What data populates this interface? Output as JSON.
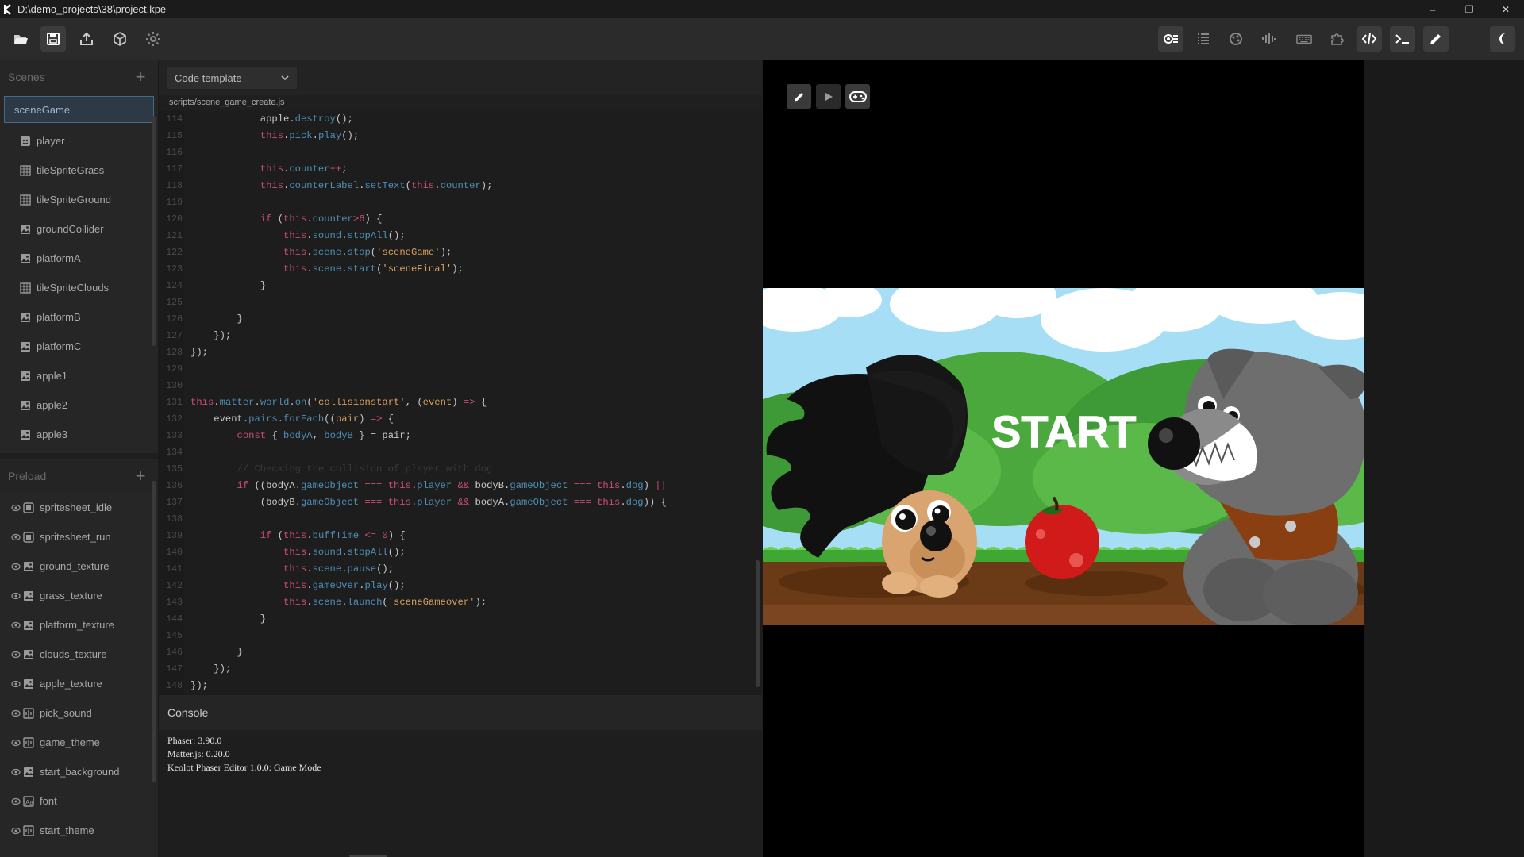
{
  "window": {
    "title": "D:\\demo_projects\\38\\project.kpe",
    "minimize": "–",
    "restore": "❐",
    "close": "✕"
  },
  "sidebar": {
    "scenes_label": "Scenes",
    "scene_selected": "sceneGame",
    "objects": [
      {
        "label": "player",
        "icon": "sprite-icon"
      },
      {
        "label": "tileSpriteGrass",
        "icon": "tilesprite-icon"
      },
      {
        "label": "tileSpriteGround",
        "icon": "tilesprite-icon"
      },
      {
        "label": "groundCollider",
        "icon": "image-icon"
      },
      {
        "label": "platformA",
        "icon": "image-icon"
      },
      {
        "label": "tileSpriteClouds",
        "icon": "tilesprite-icon"
      },
      {
        "label": "platformB",
        "icon": "image-icon"
      },
      {
        "label": "platformC",
        "icon": "image-icon"
      },
      {
        "label": "apple1",
        "icon": "image-icon"
      },
      {
        "label": "apple2",
        "icon": "image-icon"
      },
      {
        "label": "apple3",
        "icon": "image-icon"
      }
    ],
    "preload_label": "Preload",
    "preload": [
      {
        "label": "spritesheet_idle",
        "icon": "spritesheet-icon"
      },
      {
        "label": "spritesheet_run",
        "icon": "spritesheet-icon"
      },
      {
        "label": "ground_texture",
        "icon": "image-icon"
      },
      {
        "label": "grass_texture",
        "icon": "image-icon"
      },
      {
        "label": "platform_texture",
        "icon": "image-icon"
      },
      {
        "label": "clouds_texture",
        "icon": "image-icon"
      },
      {
        "label": "apple_texture",
        "icon": "image-icon"
      },
      {
        "label": "pick_sound",
        "icon": "audio-icon"
      },
      {
        "label": "game_theme",
        "icon": "audio-icon"
      },
      {
        "label": "start_background",
        "icon": "image-icon"
      },
      {
        "label": "font",
        "icon": "font-icon"
      },
      {
        "label": "start_theme",
        "icon": "audio-icon"
      }
    ]
  },
  "editor": {
    "template_select": "Code template",
    "file_path": "scripts/scene_game_create.js",
    "lines": [
      {
        "n": "114",
        "segs": [
          [
            "pl",
            "            apple."
          ],
          [
            "pr",
            "destroy"
          ],
          [
            "pl",
            "();"
          ]
        ]
      },
      {
        "n": "115",
        "segs": [
          [
            "kw",
            "            this"
          ],
          [
            "pl",
            "."
          ],
          [
            "pr",
            "pick"
          ],
          [
            "pl",
            "."
          ],
          [
            "pr",
            "play"
          ],
          [
            "pl",
            "();"
          ]
        ]
      },
      {
        "n": "116",
        "segs": []
      },
      {
        "n": "117",
        "segs": [
          [
            "kw",
            "            this"
          ],
          [
            "pl",
            "."
          ],
          [
            "pr",
            "counter"
          ],
          [
            "kw",
            "++"
          ],
          [
            "pl",
            ";"
          ]
        ]
      },
      {
        "n": "118",
        "segs": [
          [
            "kw",
            "            this"
          ],
          [
            "pl",
            "."
          ],
          [
            "pr",
            "counterLabel"
          ],
          [
            "pl",
            "."
          ],
          [
            "pr",
            "setText"
          ],
          [
            "pl",
            "("
          ],
          [
            "kw",
            "this"
          ],
          [
            "pl",
            "."
          ],
          [
            "pr",
            "counter"
          ],
          [
            "pl",
            ");"
          ]
        ]
      },
      {
        "n": "119",
        "segs": []
      },
      {
        "n": "120",
        "segs": [
          [
            "kw",
            "            if"
          ],
          [
            "pl",
            " ("
          ],
          [
            "kw",
            "this"
          ],
          [
            "pl",
            "."
          ],
          [
            "pr",
            "counter"
          ],
          [
            "kw",
            ">"
          ],
          [
            "nm",
            "6"
          ],
          [
            "pl",
            ") {"
          ]
        ]
      },
      {
        "n": "121",
        "segs": [
          [
            "kw",
            "                this"
          ],
          [
            "pl",
            "."
          ],
          [
            "pr",
            "sound"
          ],
          [
            "pl",
            "."
          ],
          [
            "pr",
            "stopAll"
          ],
          [
            "pl",
            "();"
          ]
        ]
      },
      {
        "n": "122",
        "segs": [
          [
            "kw",
            "                this"
          ],
          [
            "pl",
            "."
          ],
          [
            "pr",
            "scene"
          ],
          [
            "pl",
            "."
          ],
          [
            "pr",
            "stop"
          ],
          [
            "pl",
            "("
          ],
          [
            "st",
            "'sceneGame'"
          ],
          [
            "pl",
            ");"
          ]
        ]
      },
      {
        "n": "123",
        "segs": [
          [
            "kw",
            "                this"
          ],
          [
            "pl",
            "."
          ],
          [
            "pr",
            "scene"
          ],
          [
            "pl",
            "."
          ],
          [
            "pr",
            "start"
          ],
          [
            "pl",
            "("
          ],
          [
            "st",
            "'sceneFinal'"
          ],
          [
            "pl",
            ");"
          ]
        ]
      },
      {
        "n": "124",
        "segs": [
          [
            "pl",
            "            }"
          ]
        ]
      },
      {
        "n": "125",
        "segs": []
      },
      {
        "n": "126",
        "segs": [
          [
            "pl",
            "        }"
          ]
        ]
      },
      {
        "n": "127",
        "segs": [
          [
            "pl",
            "    });"
          ]
        ]
      },
      {
        "n": "128",
        "segs": [
          [
            "pl",
            "});"
          ]
        ]
      },
      {
        "n": "129",
        "segs": []
      },
      {
        "n": "130",
        "segs": []
      },
      {
        "n": "131",
        "segs": [
          [
            "kw",
            "this"
          ],
          [
            "pl",
            "."
          ],
          [
            "pr",
            "matter"
          ],
          [
            "pl",
            "."
          ],
          [
            "pr",
            "world"
          ],
          [
            "pl",
            "."
          ],
          [
            "pr",
            "on"
          ],
          [
            "pl",
            "("
          ],
          [
            "st",
            "'collisionstart'"
          ],
          [
            "pl",
            ", ("
          ],
          [
            "st",
            "event"
          ],
          [
            "pl",
            ") "
          ],
          [
            "kw",
            "=>"
          ],
          [
            "pl",
            " {"
          ]
        ]
      },
      {
        "n": "132",
        "segs": [
          [
            "pl",
            "    event."
          ],
          [
            "pr",
            "pairs"
          ],
          [
            "pl",
            "."
          ],
          [
            "pr",
            "forEach"
          ],
          [
            "pl",
            "(("
          ],
          [
            "st",
            "pair"
          ],
          [
            "pl",
            ") "
          ],
          [
            "kw",
            "=>"
          ],
          [
            "pl",
            " {"
          ]
        ]
      },
      {
        "n": "133",
        "segs": [
          [
            "kw",
            "        const"
          ],
          [
            "pl",
            " { "
          ],
          [
            "pr",
            "bodyA"
          ],
          [
            "pl",
            ", "
          ],
          [
            "pr",
            "bodyB"
          ],
          [
            "pl",
            " } = pair;"
          ]
        ]
      },
      {
        "n": "134",
        "segs": []
      },
      {
        "n": "135",
        "segs": [
          [
            "cm",
            "        // Checking the collision of player with dog"
          ]
        ]
      },
      {
        "n": "136",
        "segs": [
          [
            "kw",
            "        if"
          ],
          [
            "pl",
            " ((bodyA."
          ],
          [
            "pr",
            "gameObject"
          ],
          [
            "kw",
            " === "
          ],
          [
            "kw",
            "this"
          ],
          [
            "pl",
            "."
          ],
          [
            "pr",
            "player"
          ],
          [
            "kw",
            " && "
          ],
          [
            "pl",
            "bodyB."
          ],
          [
            "pr",
            "gameObject"
          ],
          [
            "kw",
            " === "
          ],
          [
            "kw",
            "this"
          ],
          [
            "pl",
            "."
          ],
          [
            "pr",
            "dog"
          ],
          [
            "pl",
            ") "
          ],
          [
            "kw",
            "||"
          ]
        ]
      },
      {
        "n": "137",
        "segs": [
          [
            "pl",
            "            (bodyB."
          ],
          [
            "pr",
            "gameObject"
          ],
          [
            "kw",
            " === "
          ],
          [
            "kw",
            "this"
          ],
          [
            "pl",
            "."
          ],
          [
            "pr",
            "player"
          ],
          [
            "kw",
            " && "
          ],
          [
            "pl",
            "bodyA."
          ],
          [
            "pr",
            "gameObject"
          ],
          [
            "kw",
            " === "
          ],
          [
            "kw",
            "this"
          ],
          [
            "pl",
            "."
          ],
          [
            "pr",
            "dog"
          ],
          [
            "pl",
            ")) {"
          ]
        ]
      },
      {
        "n": "138",
        "segs": []
      },
      {
        "n": "139",
        "segs": [
          [
            "kw",
            "            if"
          ],
          [
            "pl",
            " ("
          ],
          [
            "kw",
            "this"
          ],
          [
            "pl",
            "."
          ],
          [
            "pr",
            "buffTime"
          ],
          [
            "kw",
            " <= "
          ],
          [
            "nm",
            "0"
          ],
          [
            "pl",
            ") {"
          ]
        ]
      },
      {
        "n": "140",
        "segs": [
          [
            "kw",
            "                this"
          ],
          [
            "pl",
            "."
          ],
          [
            "pr",
            "sound"
          ],
          [
            "pl",
            "."
          ],
          [
            "pr",
            "stopAll"
          ],
          [
            "pl",
            "();"
          ]
        ]
      },
      {
        "n": "141",
        "segs": [
          [
            "kw",
            "                this"
          ],
          [
            "pl",
            "."
          ],
          [
            "pr",
            "scene"
          ],
          [
            "pl",
            "."
          ],
          [
            "pr",
            "pause"
          ],
          [
            "pl",
            "();"
          ]
        ]
      },
      {
        "n": "142",
        "segs": [
          [
            "kw",
            "                this"
          ],
          [
            "pl",
            "."
          ],
          [
            "pr",
            "gameOver"
          ],
          [
            "pl",
            "."
          ],
          [
            "pr",
            "play"
          ],
          [
            "pl",
            "();"
          ]
        ]
      },
      {
        "n": "143",
        "segs": [
          [
            "kw",
            "                this"
          ],
          [
            "pl",
            "."
          ],
          [
            "pr",
            "scene"
          ],
          [
            "pl",
            "."
          ],
          [
            "pr",
            "launch"
          ],
          [
            "pl",
            "("
          ],
          [
            "st",
            "'sceneGameover'"
          ],
          [
            "pl",
            ");"
          ]
        ]
      },
      {
        "n": "144",
        "segs": [
          [
            "pl",
            "            }"
          ]
        ]
      },
      {
        "n": "145",
        "segs": []
      },
      {
        "n": "146",
        "segs": [
          [
            "pl",
            "        }"
          ]
        ]
      },
      {
        "n": "147",
        "segs": [
          [
            "pl",
            "    });"
          ]
        ]
      },
      {
        "n": "148",
        "segs": [
          [
            "pl",
            "});"
          ]
        ]
      }
    ]
  },
  "console": {
    "title": "Console",
    "lines": [
      "Phaser: 3.90.0",
      "Matter.js: 0.20.0",
      "Keolot Phaser Editor 1.0.0: Game Mode"
    ]
  },
  "game": {
    "start_text": "START"
  },
  "colors": {
    "accent": "#3f6a8a",
    "sky": "#9fdcf5",
    "grass": "#4caf35",
    "ground": "#6b3a16"
  }
}
